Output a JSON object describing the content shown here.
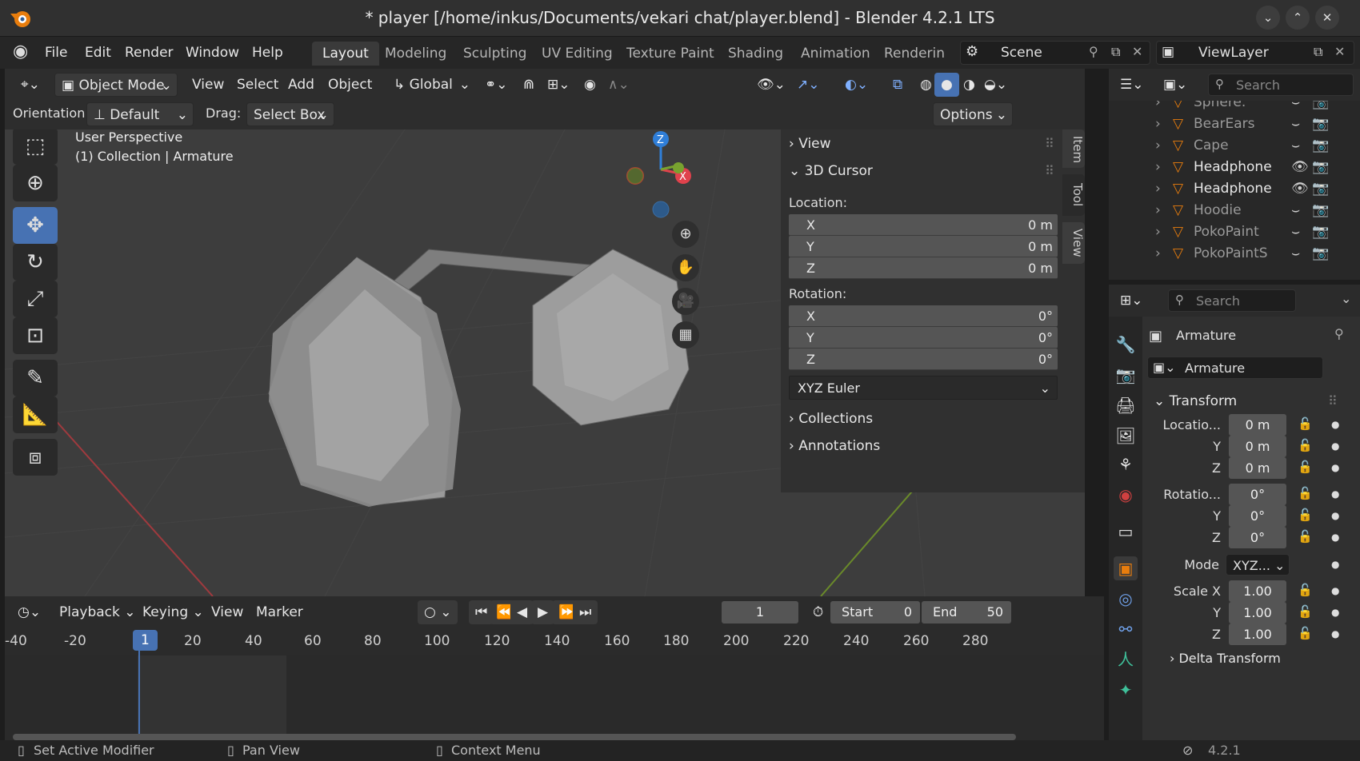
{
  "window": {
    "title": "* player [/home/inkus/Documents/vekari chat/player.blend] - Blender 4.2.1 LTS"
  },
  "menu": {
    "file": "File",
    "edit": "Edit",
    "render": "Render",
    "window": "Window",
    "help": "Help"
  },
  "workspaces": [
    "Layout",
    "Modeling",
    "Sculpting",
    "UV Editing",
    "Texture Paint",
    "Shading",
    "Animation",
    "Renderin"
  ],
  "scene": {
    "label": "Scene",
    "viewlayer": "ViewLayer"
  },
  "viewport_header": {
    "mode": "Object Mode",
    "view": "View",
    "select": "Select",
    "add": "Add",
    "object": "Object",
    "transform": "Global"
  },
  "tool_settings": {
    "orientation_label": "Orientation:",
    "orientation": "Default",
    "drag_label": "Drag:",
    "drag": "Select Box",
    "options": "Options"
  },
  "viewport": {
    "perspective": "User Perspective",
    "context": "(1) Collection | Armature"
  },
  "npanel": {
    "view": "View",
    "cursor": "3D Cursor",
    "location_label": "Location:",
    "location": [
      {
        "axis": "X",
        "value": "0 m"
      },
      {
        "axis": "Y",
        "value": "0 m"
      },
      {
        "axis": "Z",
        "value": "0 m"
      }
    ],
    "rotation_label": "Rotation:",
    "rotation": [
      {
        "axis": "X",
        "value": "0°"
      },
      {
        "axis": "Y",
        "value": "0°"
      },
      {
        "axis": "Z",
        "value": "0°"
      }
    ],
    "rotation_mode": "XYZ Euler",
    "collections": "Collections",
    "annotations": "Annotations",
    "tabs": [
      "Item",
      "Tool",
      "View"
    ]
  },
  "timeline": {
    "playback": "Playback",
    "keying": "Keying",
    "view": "View",
    "marker": "Marker",
    "current": "1",
    "start_label": "Start",
    "start": "0",
    "end_label": "End",
    "end": "50",
    "ticks": [
      "-40",
      "-20",
      "1",
      "20",
      "40",
      "60",
      "80",
      "100",
      "120",
      "140",
      "160",
      "180",
      "200",
      "220",
      "240",
      "260",
      "280"
    ]
  },
  "outliner": {
    "search": "Search",
    "items": [
      "Sphere.",
      "BearEars",
      "Cape",
      "Headphone",
      "Headphone",
      "Hoodie",
      "PokoPaint",
      "PokoPaintS"
    ]
  },
  "properties": {
    "search": "Search",
    "object_name": "Armature",
    "data_name": "Armature",
    "transform": "Transform",
    "location_label": "Locatio...",
    "rotation_label": "Rotatio...",
    "mode_label": "Mode",
    "mode": "XYZ...",
    "scale_label": "Scale X",
    "location": [
      "0 m",
      "0 m",
      "0 m"
    ],
    "rotation": [
      "0°",
      "0°",
      "0°"
    ],
    "scale": [
      "1.00",
      "1.00",
      "1.00"
    ],
    "y_label": "Y",
    "z_label": "Z",
    "delta": "Delta Transform"
  },
  "status": {
    "left": "Set Active Modifier",
    "mid": "Pan View",
    "right": "Context Menu",
    "version": "4.2.1"
  },
  "colors": {
    "accent": "#4772b3",
    "orange": "#e87d0d",
    "axis_x": "#e0424c",
    "axis_y": "#78a22f",
    "axis_z": "#2f7ed8"
  }
}
